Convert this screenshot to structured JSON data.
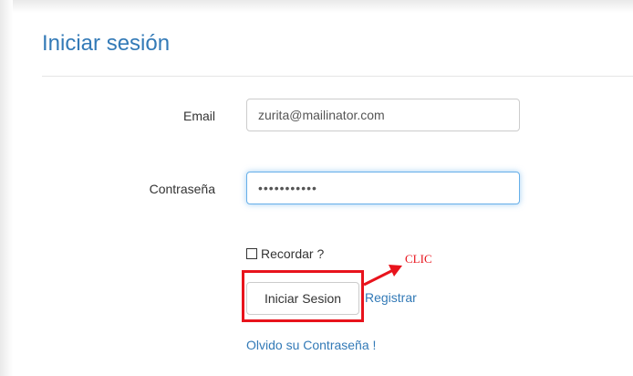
{
  "panel": {
    "title": "Iniciar sesión"
  },
  "form": {
    "email_label": "Email",
    "email_value": "zurita@mailinator.com",
    "password_label": "Contraseña",
    "password_value": "•••••••••••",
    "remember_label": "Recordar ?",
    "remember_checked": false,
    "submit_label": "Iniciar Sesion",
    "register_link": "Registrar",
    "forgot_link": "Olvido su Contraseña !"
  },
  "annotation": {
    "text": "CLIC",
    "color": "#e8131c"
  },
  "colors": {
    "title": "#337ab7",
    "link": "#337ab7",
    "focus_border": "#66afe9"
  }
}
